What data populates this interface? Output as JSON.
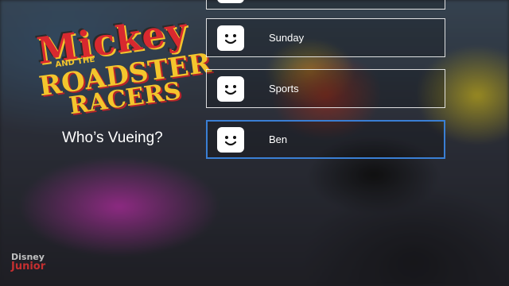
{
  "background": {
    "logo": {
      "line1": "Mickey",
      "line2": "AND THE",
      "line3": "ROADSTER",
      "line4": "RACERS"
    },
    "brand": {
      "line1": "Disney",
      "line2": "Junior"
    }
  },
  "prompt": "Who’s Vueing?",
  "profiles": [
    {
      "name": ""
    },
    {
      "name": "Sunday"
    },
    {
      "name": "Sports"
    },
    {
      "name": "Ben"
    }
  ],
  "selected_profile": "Ben",
  "colors": {
    "selection": "#3a7fd4",
    "border": "#ffffff",
    "text": "#ffffff"
  },
  "icons": {
    "avatar": "smiley-face-icon"
  }
}
